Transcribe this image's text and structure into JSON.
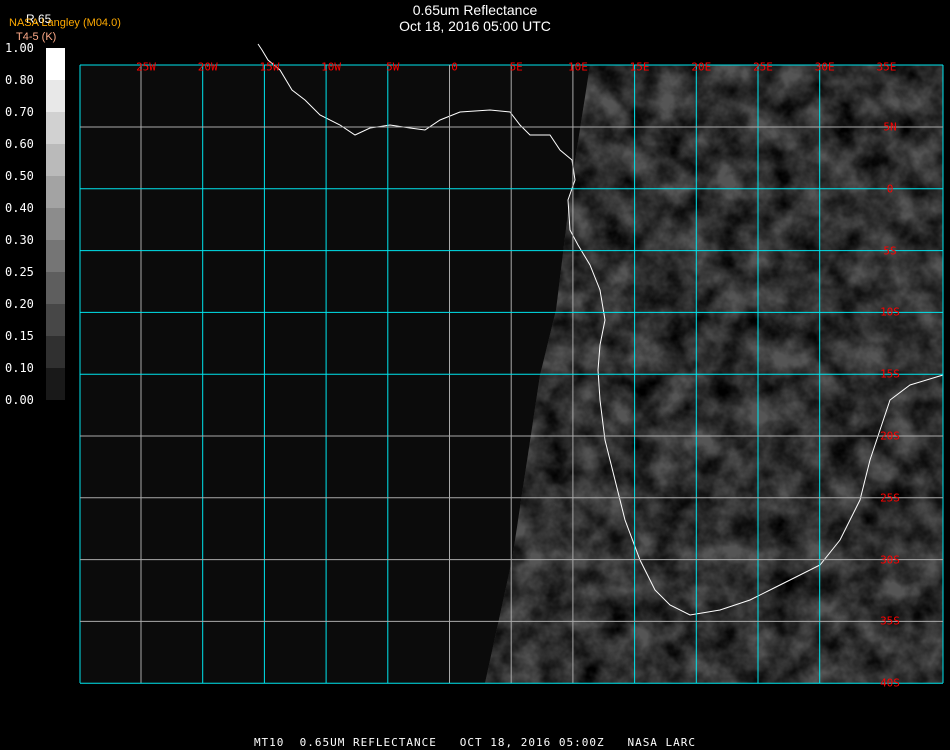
{
  "header": {
    "title": "0.65um Reflectance",
    "subtitle": "Oct 18, 2016 05:00 UTC"
  },
  "legend": {
    "top_label": "R.65",
    "org": "NASA Langley (M04.0)",
    "sub": "T4-5 (K)",
    "ticks": [
      "1.00",
      "0.80",
      "0.70",
      "0.60",
      "0.50",
      "0.40",
      "0.30",
      "0.25",
      "0.20",
      "0.15",
      "0.10",
      "0.00"
    ],
    "colors": {
      "org": "#ffaa00",
      "sub": "#ffaa88"
    }
  },
  "longitudes": [
    "25W",
    "20W",
    "15W",
    "10W",
    "5W",
    "0",
    "5E",
    "10E",
    "15E",
    "20E",
    "25E",
    "30E",
    "35E"
  ],
  "latitudes": [
    "5N",
    "0",
    "5S",
    "10S",
    "15S",
    "20S",
    "25S",
    "30S",
    "35S",
    "40S"
  ],
  "colors": {
    "grid": "#00e5ee",
    "label": "#ff0000",
    "coast": "#ffffff"
  },
  "caption": "MT10  0.65UM REFLECTANCE   OCT 18, 2016 05:00Z   NASA LARC"
}
